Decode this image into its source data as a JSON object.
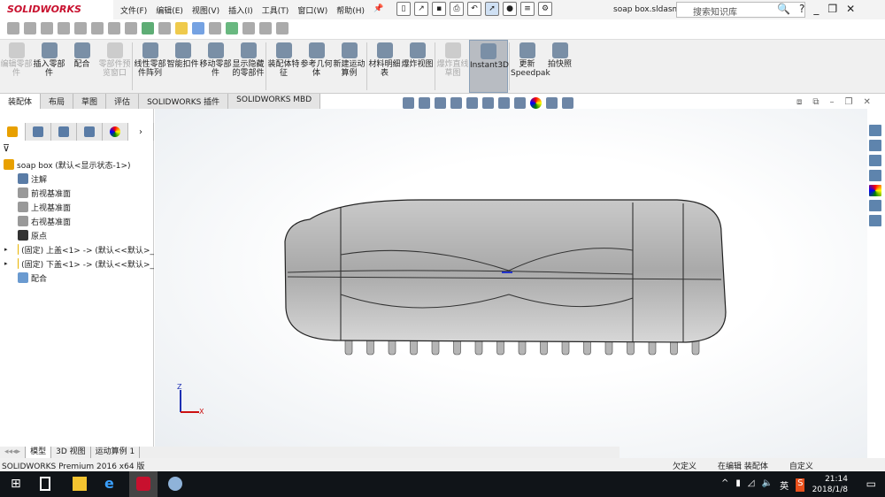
{
  "app": {
    "logo": "SOLIDWORKS",
    "file_name": "soap box.sldasm"
  },
  "menu": [
    "文件(F)",
    "编辑(E)",
    "视图(V)",
    "插入(I)",
    "工具(T)",
    "窗口(W)",
    "帮助(H)"
  ],
  "search": {
    "placeholder": "搜索知识库"
  },
  "ribbon": [
    {
      "label": "编辑零部件",
      "disabled": true
    },
    {
      "label": "插入零部件",
      "disabled": false
    },
    {
      "label": "配合",
      "disabled": false
    },
    {
      "label": "零部件预览窗口",
      "disabled": true
    },
    {
      "label": "线性零部件阵列",
      "disabled": false
    },
    {
      "label": "智能扣件",
      "disabled": false
    },
    {
      "label": "移动零部件",
      "disabled": false
    },
    {
      "label": "显示隐藏的零部件",
      "disabled": false
    },
    {
      "label": "装配体特征",
      "disabled": false
    },
    {
      "label": "参考几何体",
      "disabled": false
    },
    {
      "label": "新建运动算例",
      "disabled": false
    },
    {
      "label": "材料明细表",
      "disabled": false
    },
    {
      "label": "爆炸视图",
      "disabled": false
    },
    {
      "label": "爆炸直线草图",
      "disabled": true
    },
    {
      "label": "Instant3D",
      "disabled": false,
      "selected": true
    },
    {
      "label": "更新Speedpak",
      "disabled": false
    },
    {
      "label": "拍快照",
      "disabled": false
    }
  ],
  "tabs": [
    "装配体",
    "布局",
    "草图",
    "评估",
    "SOLIDWORKS 插件",
    "SOLIDWORKS MBD"
  ],
  "tree": [
    {
      "label": "soap box  (默认<显示状态-1>)",
      "level": 0,
      "icon": "assembly-icon"
    },
    {
      "label": "注解",
      "level": 1,
      "icon": "annotation-icon"
    },
    {
      "label": "前视基准面",
      "level": 1,
      "icon": "plane-icon"
    },
    {
      "label": "上视基准面",
      "level": 1,
      "icon": "plane-icon"
    },
    {
      "label": "右视基准面",
      "level": 1,
      "icon": "plane-icon"
    },
    {
      "label": "原点",
      "level": 1,
      "icon": "origin-icon"
    },
    {
      "label": "(固定) 上盖<1> -> (默认<<默认>_",
      "level": 1,
      "icon": "part-icon",
      "expand": true
    },
    {
      "label": "(固定) 下盖<1> -> (默认<<默认>_",
      "level": 1,
      "icon": "part-icon",
      "expand": true
    },
    {
      "label": "配合",
      "level": 1,
      "icon": "mates-icon"
    }
  ],
  "bottom_tabs": [
    "模型",
    "3D 视图",
    "运动算例 1"
  ],
  "status": {
    "left": "SOLIDWORKS Premium 2016 x64 版",
    "items": [
      "欠定义",
      "在编辑 装配体",
      "自定义"
    ]
  },
  "triad": {
    "z": "Z",
    "x": "X"
  },
  "taskbar": {
    "time": "21:14",
    "date": "2018/1/8",
    "ime": "英"
  }
}
